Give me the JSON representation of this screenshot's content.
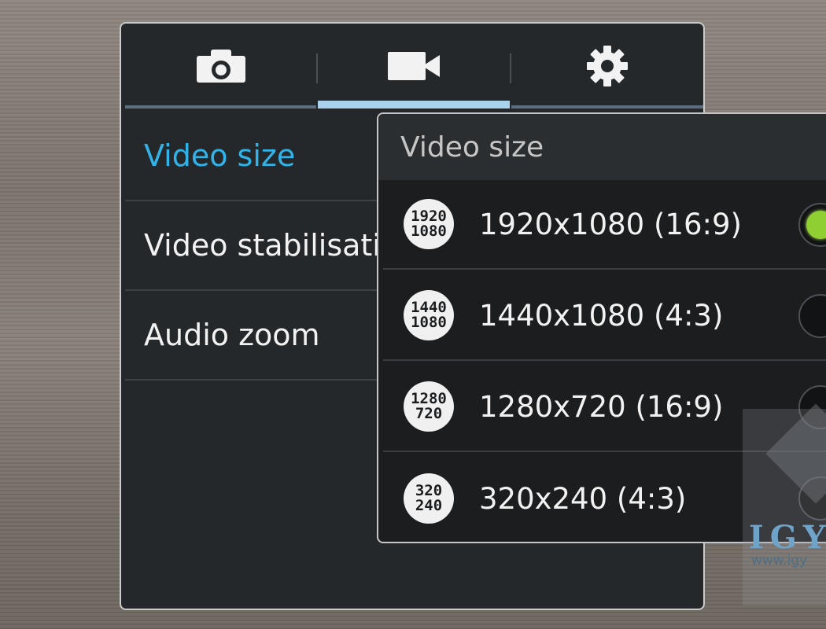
{
  "colors": {
    "accent": "#31b3e8",
    "tab_active_underline": "#a9d2ec",
    "radio_selected": "#8fcf32",
    "panel_bg": "#25282b",
    "dialog_bg": "#1b1d1f"
  },
  "tabs": [
    {
      "icon": "camera-icon",
      "active": false
    },
    {
      "icon": "video-camera-icon",
      "active": true
    },
    {
      "icon": "gear-icon",
      "active": false
    }
  ],
  "settings_list": [
    {
      "label": "Video size",
      "selected": true
    },
    {
      "label": "Video stabilisation",
      "selected": false
    },
    {
      "label": "Audio zoom",
      "selected": false
    }
  ],
  "dialog": {
    "title": "Video size",
    "options": [
      {
        "icon_top": "1920",
        "icon_bottom": "1080",
        "label": "1920x1080 (16:9)",
        "selected": true
      },
      {
        "icon_top": "1440",
        "icon_bottom": "1080",
        "label": "1440x1080 (4:3)",
        "selected": false
      },
      {
        "icon_top": "1280",
        "icon_bottom": "720",
        "label": "1280x720 (16:9)",
        "selected": false
      },
      {
        "icon_top": "320",
        "icon_bottom": "240",
        "label": "320x240 (4:3)",
        "selected": false
      }
    ]
  },
  "watermark": {
    "brand": "IGY",
    "url": "www.igy"
  }
}
